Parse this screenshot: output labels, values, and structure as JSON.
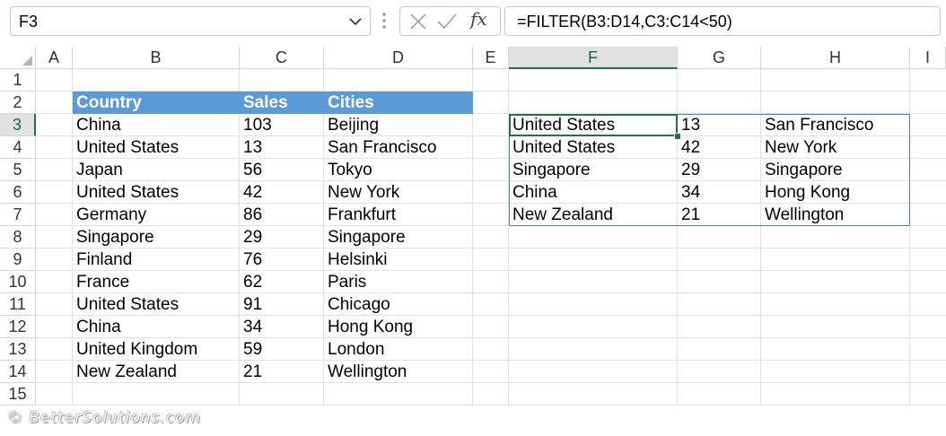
{
  "name_box": "F3",
  "formula": "=FILTER(B3:D14,C3:C14<50)",
  "columns": [
    "A",
    "B",
    "C",
    "D",
    "E",
    "F",
    "G",
    "H",
    "I"
  ],
  "rows": [
    "1",
    "2",
    "3",
    "4",
    "5",
    "6",
    "7",
    "8",
    "9",
    "10",
    "11",
    "12",
    "13",
    "14",
    "15"
  ],
  "selected_column": "F",
  "selected_row": "3",
  "source_headers": [
    "Country",
    "Sales",
    "Cities"
  ],
  "source_rows": [
    [
      "China",
      "103",
      "Beijing"
    ],
    [
      "United States",
      "13",
      "San Francisco"
    ],
    [
      "Japan",
      "56",
      "Tokyo"
    ],
    [
      "United States",
      "42",
      "New York"
    ],
    [
      "Germany",
      "86",
      "Frankfurt"
    ],
    [
      "Singapore",
      "29",
      "Singapore"
    ],
    [
      "Finland",
      "76",
      "Helsinki"
    ],
    [
      "France",
      "62",
      "Paris"
    ],
    [
      "United States",
      "91",
      "Chicago"
    ],
    [
      "China",
      "34",
      "Hong Kong"
    ],
    [
      "United Kingdom",
      "59",
      "London"
    ],
    [
      "New Zealand",
      "21",
      "Wellington"
    ]
  ],
  "result_rows": [
    [
      "United States",
      "13",
      "San Francisco"
    ],
    [
      "United States",
      "42",
      "New York"
    ],
    [
      "Singapore",
      "29",
      "Singapore"
    ],
    [
      "China",
      "34",
      "Hong Kong"
    ],
    [
      "New Zealand",
      "21",
      "Wellington"
    ]
  ],
  "watermark": "© BetterSolutions.com",
  "colors": {
    "header_fill": "#5b9bd5",
    "accent": "#217346",
    "spill_border": "#4a7ebb"
  }
}
